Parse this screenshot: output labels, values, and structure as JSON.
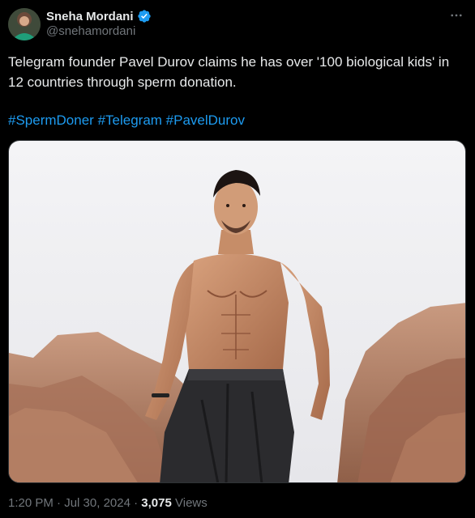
{
  "author": {
    "display_name": "Sneha Mordani",
    "handle": "@snehamordani",
    "verified": true
  },
  "tweet": {
    "text": "Telegram founder Pavel Durov claims he has over '100 biological kids' in 12 countries through sperm donation.",
    "hashtags": [
      "#SpermDoner",
      "#Telegram",
      "#PavelDurov"
    ],
    "time": "1:20 PM",
    "separator": " · ",
    "date": "Jul 30, 2024",
    "views_count": "3,075",
    "views_label": " Views"
  },
  "colors": {
    "background": "#000000",
    "text": "#e7e9ea",
    "secondary": "#71767b",
    "link": "#1d9bf0",
    "verified": "#1d9bf0"
  },
  "icons": {
    "verified": "verified-badge-icon",
    "more": "more-options-icon"
  }
}
